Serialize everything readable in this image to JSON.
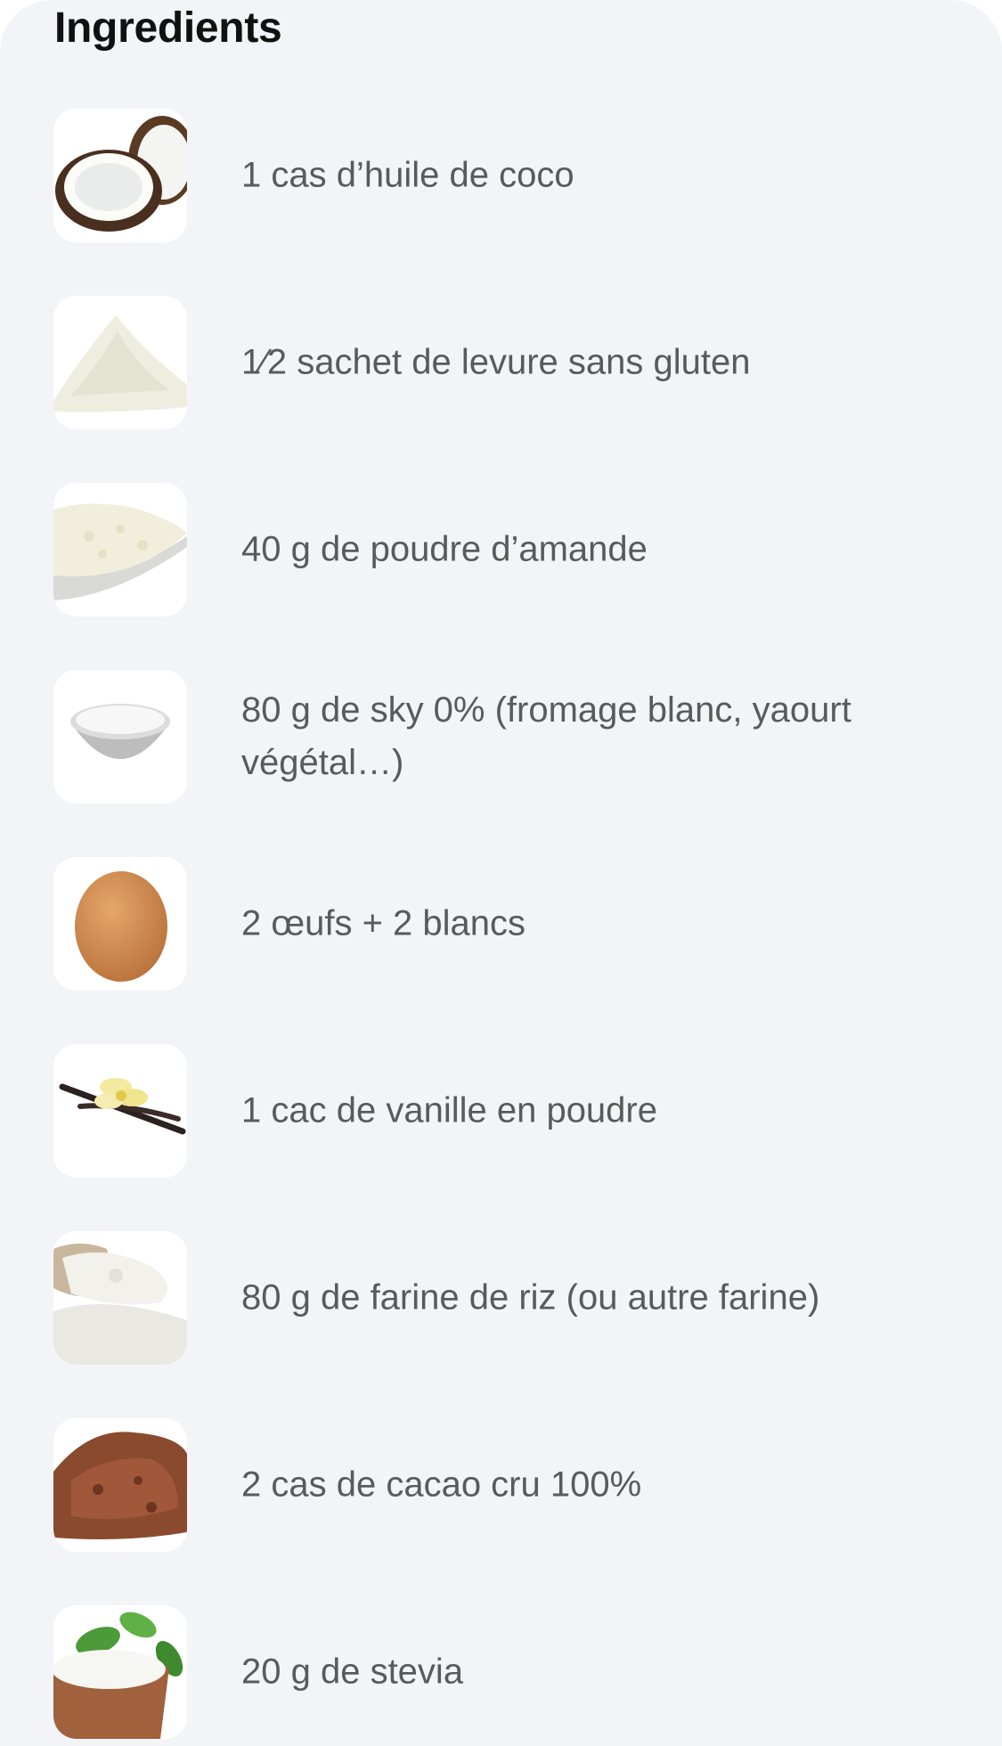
{
  "header": {
    "title": "Ingredients"
  },
  "ingredients": [
    {
      "text": "1 cas d’huile de coco",
      "icon": "coconut-icon"
    },
    {
      "text": "1⁄2 sachet de levure sans gluten",
      "icon": "flour-powder-icon"
    },
    {
      "text": "40 g de poudre d’amande",
      "icon": "almond-powder-icon"
    },
    {
      "text": "80 g de sky 0% (fromage blanc, yaourt végétal…)",
      "icon": "yogurt-bowl-icon"
    },
    {
      "text": "2 œufs + 2 blancs",
      "icon": "egg-icon"
    },
    {
      "text": "1 cac de vanille en poudre",
      "icon": "vanilla-icon"
    },
    {
      "text": "80 g de farine de riz (ou autre farine)",
      "icon": "rice-flour-icon"
    },
    {
      "text": "2 cas de cacao cru 100%",
      "icon": "cocoa-powder-icon"
    },
    {
      "text": "20 g de stevia",
      "icon": "stevia-icon"
    }
  ]
}
